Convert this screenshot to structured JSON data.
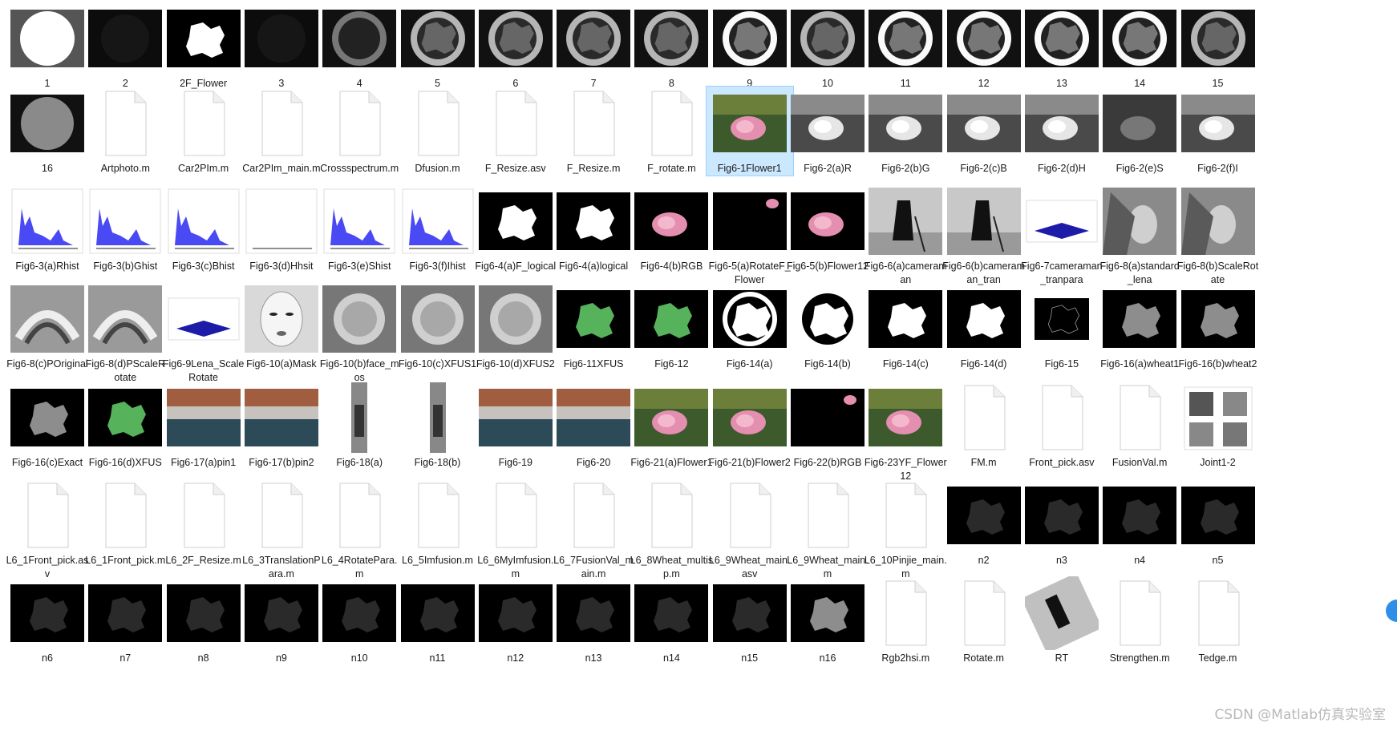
{
  "window": {
    "view": "Large icons",
    "selected_item": "Fig6-1Flower1"
  },
  "files": [
    {
      "name": "1",
      "icon": "image-white-disk"
    },
    {
      "name": "2",
      "icon": "image-black"
    },
    {
      "name": "2F_Flower",
      "icon": "image-white-mask"
    },
    {
      "name": "3",
      "icon": "image-black"
    },
    {
      "name": "4",
      "icon": "image-dim-ring"
    },
    {
      "name": "5",
      "icon": "image-ring"
    },
    {
      "name": "6",
      "icon": "image-ring"
    },
    {
      "name": "7",
      "icon": "image-ring"
    },
    {
      "name": "8",
      "icon": "image-ring"
    },
    {
      "name": "9",
      "icon": "image-ring-bright"
    },
    {
      "name": "10",
      "icon": "image-ring"
    },
    {
      "name": "11",
      "icon": "image-ring-bright"
    },
    {
      "name": "12",
      "icon": "image-ring-bright"
    },
    {
      "name": "13",
      "icon": "image-ring-bright"
    },
    {
      "name": "14",
      "icon": "image-ring-bright"
    },
    {
      "name": "15",
      "icon": "image-ring"
    },
    {
      "name": "16",
      "icon": "image-gray-blur"
    },
    {
      "name": "Artphoto.m",
      "icon": "document-icon"
    },
    {
      "name": "Car2PIm.m",
      "icon": "document-icon"
    },
    {
      "name": "Car2PIm_main.m",
      "icon": "document-icon"
    },
    {
      "name": "Crossspectrum.m",
      "icon": "document-icon"
    },
    {
      "name": "Dfusion.m",
      "icon": "document-icon"
    },
    {
      "name": "F_Resize.asv",
      "icon": "document-icon"
    },
    {
      "name": "F_Resize.m",
      "icon": "document-icon"
    },
    {
      "name": "F_rotate.m",
      "icon": "document-icon"
    },
    {
      "name": "Fig6-1Flower1",
      "icon": "image-rose"
    },
    {
      "name": "Fig6-2(a)R",
      "icon": "image-rose-gray"
    },
    {
      "name": "Fig6-2(b)G",
      "icon": "image-rose-gray"
    },
    {
      "name": "Fig6-2(c)B",
      "icon": "image-rose-gray"
    },
    {
      "name": "Fig6-2(d)H",
      "icon": "image-rose-gray"
    },
    {
      "name": "Fig6-2(e)S",
      "icon": "image-rose-dark"
    },
    {
      "name": "Fig6-2(f)I",
      "icon": "image-rose-gray"
    },
    {
      "name": "Fig6-3(a)Rhist",
      "icon": "image-histogram"
    },
    {
      "name": "Fig6-3(b)Ghist",
      "icon": "image-histogram"
    },
    {
      "name": "Fig6-3(c)Bhist",
      "icon": "image-histogram"
    },
    {
      "name": "Fig6-3(d)Hhsit",
      "icon": "image-histogram-empty"
    },
    {
      "name": "Fig6-3(e)Shist",
      "icon": "image-histogram"
    },
    {
      "name": "Fig6-3(f)Ihist",
      "icon": "image-histogram"
    },
    {
      "name": "Fig6-4(a)F_logical",
      "icon": "image-white-mask"
    },
    {
      "name": "Fig6-4(a)logical",
      "icon": "image-white-mask"
    },
    {
      "name": "Fig6-4(b)RGB",
      "icon": "image-rose-black"
    },
    {
      "name": "Fig6-5(a)RotateF_Flower",
      "icon": "image-small-rose"
    },
    {
      "name": "Fig6-5(b)Flower12",
      "icon": "image-rose-black"
    },
    {
      "name": "Fig6-6(a)cameraman",
      "icon": "image-cameraman"
    },
    {
      "name": "Fig6-6(b)cameraman_tran",
      "icon": "image-cameraman"
    },
    {
      "name": "Fig6-7cameraman_tranpara",
      "icon": "image-3d-plot"
    },
    {
      "name": "Fig6-8(a)standard_lena",
      "icon": "image-portrait"
    },
    {
      "name": "Fig6-8(b)ScaleRotate",
      "icon": "image-portrait"
    },
    {
      "name": "Fig6-8(c)POriginal",
      "icon": "image-texture"
    },
    {
      "name": "Fig6-8(d)PScaleRotate",
      "icon": "image-texture"
    },
    {
      "name": "Fig6-9Lena_ScaleRotate",
      "icon": "image-3d-plot"
    },
    {
      "name": "Fig6-10(a)Mask",
      "icon": "image-mask-face"
    },
    {
      "name": "Fig6-10(b)face_mos",
      "icon": "image-mosaic"
    },
    {
      "name": "Fig6-10(c)XFUS1",
      "icon": "image-mosaic"
    },
    {
      "name": "Fig6-10(d)XFUS2",
      "icon": "image-mosaic"
    },
    {
      "name": "Fig6-11XFUS",
      "icon": "image-green-leaf"
    },
    {
      "name": "Fig6-12",
      "icon": "image-green-leaf"
    },
    {
      "name": "Fig6-14(a)",
      "icon": "image-ring-blob"
    },
    {
      "name": "Fig6-14(b)",
      "icon": "image-inverse-blob"
    },
    {
      "name": "Fig6-14(c)",
      "icon": "image-white-mask"
    },
    {
      "name": "Fig6-14(d)",
      "icon": "image-white-mask"
    },
    {
      "name": "Fig6-15",
      "icon": "image-outline"
    },
    {
      "name": "Fig6-16(a)wheat1",
      "icon": "image-gray-leaf"
    },
    {
      "name": "Fig6-16(b)wheat2",
      "icon": "image-gray-leaf"
    },
    {
      "name": "Fig6-16(c)Exact",
      "icon": "image-gray-leaf"
    },
    {
      "name": "Fig6-16(d)XFUS",
      "icon": "image-green-leaf"
    },
    {
      "name": "Fig6-17(a)pin1",
      "icon": "image-room"
    },
    {
      "name": "Fig6-17(b)pin2",
      "icon": "image-room"
    },
    {
      "name": "Fig6-18(a)",
      "icon": "image-narrow-strip"
    },
    {
      "name": "Fig6-18(b)",
      "icon": "image-narrow-strip"
    },
    {
      "name": "Fig6-19",
      "icon": "image-room"
    },
    {
      "name": "Fig6-20",
      "icon": "image-room"
    },
    {
      "name": "Fig6-21(a)Flower1",
      "icon": "image-rose"
    },
    {
      "name": "Fig6-21(b)Flower2",
      "icon": "image-rose"
    },
    {
      "name": "Fig6-22(b)RGB",
      "icon": "image-small-rose"
    },
    {
      "name": "Fig6-23YF_Flower12",
      "icon": "image-rose"
    },
    {
      "name": "FM.m",
      "icon": "document-icon"
    },
    {
      "name": "Front_pick.asv",
      "icon": "document-icon"
    },
    {
      "name": "FusionVal.m",
      "icon": "document-icon"
    },
    {
      "name": "Joint1-2",
      "icon": "image-grid-4"
    },
    {
      "name": "L6_1Front_pick.asv",
      "icon": "document-icon"
    },
    {
      "name": "L6_1Front_pick.m",
      "icon": "document-icon"
    },
    {
      "name": "L6_2F_Resize.m",
      "icon": "document-icon"
    },
    {
      "name": "L6_3TranslationPara.m",
      "icon": "document-icon"
    },
    {
      "name": "L6_4RotatePara.m",
      "icon": "document-icon"
    },
    {
      "name": "L6_5Imfusion.m",
      "icon": "document-icon"
    },
    {
      "name": "L6_6MyImfusion.m",
      "icon": "document-icon"
    },
    {
      "name": "L6_7FusionVal_main.m",
      "icon": "document-icon"
    },
    {
      "name": "L6_8Wheat_multisp.m",
      "icon": "document-icon"
    },
    {
      "name": "L6_9Wheat_main.asv",
      "icon": "document-icon"
    },
    {
      "name": "L6_9Wheat_main.m",
      "icon": "document-icon"
    },
    {
      "name": "L6_10Pinjie_main.m",
      "icon": "document-icon"
    },
    {
      "name": "n2",
      "icon": "image-dark-leaf"
    },
    {
      "name": "n3",
      "icon": "image-dark-leaf"
    },
    {
      "name": "n4",
      "icon": "image-dark-leaf"
    },
    {
      "name": "n5",
      "icon": "image-dark-leaf"
    },
    {
      "name": "n6",
      "icon": "image-dark-leaf"
    },
    {
      "name": "n7",
      "icon": "image-dark-leaf"
    },
    {
      "name": "n8",
      "icon": "image-dark-leaf"
    },
    {
      "name": "n9",
      "icon": "image-dark-leaf"
    },
    {
      "name": "n10",
      "icon": "image-dark-leaf"
    },
    {
      "name": "n11",
      "icon": "image-dark-leaf"
    },
    {
      "name": "n12",
      "icon": "image-dark-leaf"
    },
    {
      "name": "n13",
      "icon": "image-dark-leaf"
    },
    {
      "name": "n14",
      "icon": "image-dark-leaf"
    },
    {
      "name": "n15",
      "icon": "image-dark-leaf"
    },
    {
      "name": "n16",
      "icon": "image-gray-leaf"
    },
    {
      "name": "Rgb2hsi.m",
      "icon": "document-icon"
    },
    {
      "name": "Rotate.m",
      "icon": "document-icon"
    },
    {
      "name": "RT",
      "icon": "image-cameraman-rotated"
    },
    {
      "name": "Strengthen.m",
      "icon": "document-icon"
    },
    {
      "name": "Tedge.m",
      "icon": "document-icon"
    }
  ],
  "watermark": "CSDN @Matlab仿真实验室",
  "colors": {
    "selection": "#cce8ff",
    "selection_border": "#99d1ff",
    "edge_widget": "#2f8fe8"
  }
}
